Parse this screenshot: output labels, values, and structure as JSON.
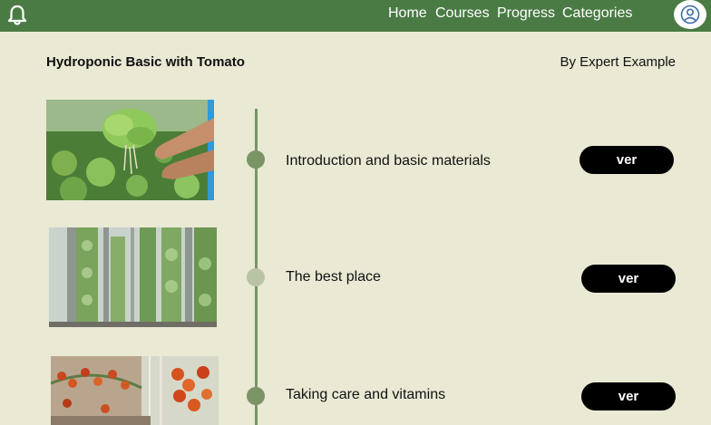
{
  "nav": {
    "links": [
      "Home",
      "Courses",
      "Progress",
      "Categories"
    ]
  },
  "course": {
    "title": "Hydroponic Basic with Tomato",
    "author": "By Expert Example"
  },
  "lessons": [
    {
      "title": "Introduction and basic materials",
      "button": "ver",
      "image": "lettuce-hands-photo"
    },
    {
      "title": "The best place",
      "button": "ver",
      "image": "vertical-tower-greenhouse-photo"
    },
    {
      "title": "Taking care and vitamins",
      "button": "ver",
      "image": "cherry-tomato-greenhouse-photo"
    }
  ],
  "colors": {
    "header": "#4b7b45",
    "background": "#eae9d4",
    "timeline": "#7a9466",
    "button": "#000000"
  },
  "icons": {
    "notification": "bell-icon",
    "profile": "user-profile-icon"
  }
}
